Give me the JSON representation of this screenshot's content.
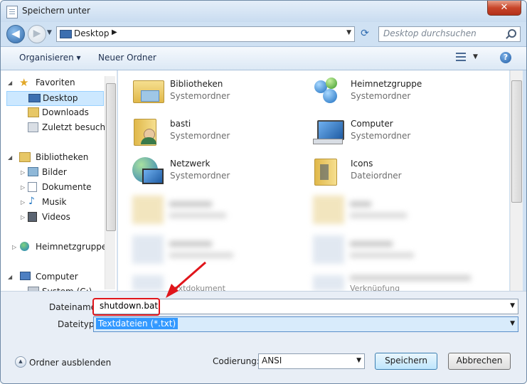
{
  "window": {
    "title": "Speichern unter",
    "close_label": "✕"
  },
  "address": {
    "location": "Desktop",
    "search_placeholder": "Desktop durchsuchen"
  },
  "toolbar": {
    "organize": "Organisieren ▾",
    "new_folder": "Neuer Ordner"
  },
  "nav": {
    "favorites": "Favoriten",
    "desktop": "Desktop",
    "downloads": "Downloads",
    "recent": "Zuletzt besucht",
    "libraries": "Bibliotheken",
    "pictures": "Bilder",
    "documents": "Dokumente",
    "music": "Musik",
    "videos": "Videos",
    "homegroup": "Heimnetzgruppe",
    "computer": "Computer",
    "system_drive": "System (C:)"
  },
  "files": [
    {
      "name": "Bibliotheken",
      "type": "Systemordner",
      "icon": "libraries-icon"
    },
    {
      "name": "Heimnetzgruppe",
      "type": "Systemordner",
      "icon": "homegroup-icon"
    },
    {
      "name": "basti",
      "type": "Systemordner",
      "icon": "user-folder-icon"
    },
    {
      "name": "Computer",
      "type": "Systemordner",
      "icon": "computer-icon"
    },
    {
      "name": "Netzwerk",
      "type": "Systemordner",
      "icon": "network-icon"
    },
    {
      "name": "Icons",
      "type": "Dateiordner",
      "icon": "folder-icon"
    }
  ],
  "blurred_files": {
    "left_partial": "extdokument",
    "right_partial": "Verknüpfung"
  },
  "form": {
    "filename_label": "Dateiname:",
    "filename_value": "shutdown.bat",
    "filetype_label": "Dateityp:",
    "filetype_value": "Textdateien (*.txt)",
    "encoding_label": "Codierung:",
    "encoding_value": "ANSI",
    "hide_folders": "Ordner ausblenden",
    "save": "Speichern",
    "cancel": "Abbrechen"
  },
  "colors": {
    "highlight": "#e0151b",
    "selection": "#3399ff",
    "accent": "#2f68a8"
  }
}
